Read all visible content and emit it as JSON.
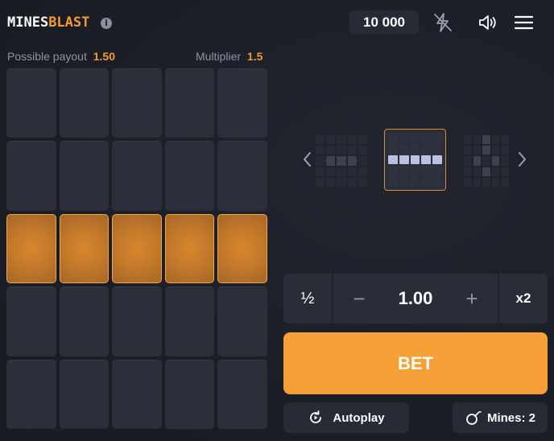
{
  "header": {
    "logo_part1": "MINES",
    "logo_part2": "BLAST",
    "info_glyph": "i",
    "balance": "10 000",
    "icons": [
      "info-icon",
      "flash-off-icon",
      "sound-icon",
      "menu-icon"
    ]
  },
  "stats": {
    "payout_label": "Possible payout",
    "payout_value": "1.50",
    "multiplier_label": "Multiplier",
    "multiplier_value": "1.5"
  },
  "board": {
    "rows": 5,
    "cols": 5,
    "highlighted_row": 3
  },
  "pattern_selector": {
    "selected_index": 1,
    "patterns": [
      "single-row",
      "full-row",
      "cross"
    ]
  },
  "bet": {
    "half_label": "½",
    "minus_label": "−",
    "amount": "1.00",
    "plus_label": "+",
    "double_label": "x2",
    "bet_label": "BET"
  },
  "footer": {
    "autoplay_label": "Autoplay",
    "mines_label": "Mines: 2"
  },
  "colors": {
    "accent": "#f8a038",
    "background": "#1c1f29",
    "tile": "#2c2f3a"
  }
}
